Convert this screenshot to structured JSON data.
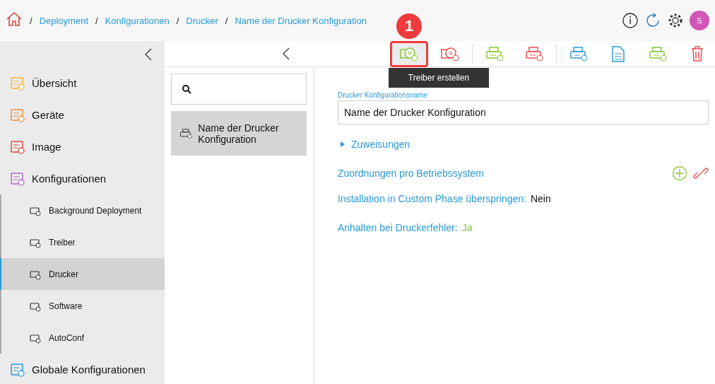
{
  "breadcrumb": {
    "separator": "/",
    "items": [
      "Deployment",
      "Konfigurationen",
      "Drucker",
      "Name der Drucker Konfiguration"
    ]
  },
  "user": {
    "initial": "S"
  },
  "sidebar": {
    "items": [
      {
        "label": "Übersicht",
        "selected": false
      },
      {
        "label": "Geräte",
        "selected": false
      },
      {
        "label": "Image",
        "selected": false
      },
      {
        "label": "Konfigurationen",
        "selected": false,
        "expanded": true,
        "children": [
          {
            "label": "Background Deployment",
            "selected": false
          },
          {
            "label": "Treiber",
            "selected": false
          },
          {
            "label": "Drucker",
            "selected": true
          },
          {
            "label": "Software",
            "selected": false
          },
          {
            "label": "AutoConf",
            "selected": false
          }
        ]
      },
      {
        "label": "Globale Konfigurationen",
        "selected": false
      }
    ]
  },
  "toolbar": {
    "groups": [
      [
        {
          "highlighted": true
        },
        {
          "highlighted": false
        }
      ],
      [
        {
          "highlighted": false
        },
        {
          "highlighted": false
        }
      ],
      [
        {
          "highlighted": false
        },
        {
          "highlighted": false
        },
        {
          "highlighted": false
        },
        {
          "highlighted": false
        }
      ]
    ],
    "callout": "1",
    "tooltip": "Treiber erstellen"
  },
  "list": {
    "items": [
      {
        "label": "Name der Drucker Konfiguration",
        "selected": true
      }
    ]
  },
  "detail": {
    "name_label": "Drucker Konfigurationsname",
    "name_value": "Name der Drucker Konfiguration",
    "assignments": {
      "label": "Zuweisungen",
      "expanded": false
    },
    "os_mapping": "Zuordnungen pro Betriebssystem",
    "fields": [
      {
        "label": "Installation in Custom Phase überspringen:",
        "value": "Nein",
        "kind": "plain"
      },
      {
        "label": "Anhalten bei Druckerfehler:",
        "value": "Ja",
        "kind": "positive"
      }
    ]
  }
}
